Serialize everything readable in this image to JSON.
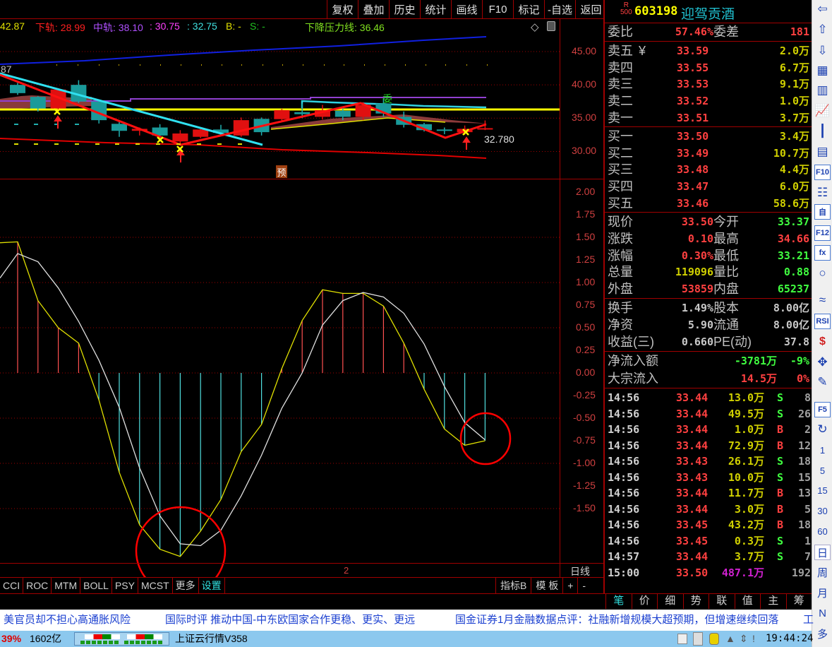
{
  "toolbar": [
    "复权",
    "叠加",
    "历史",
    "统计",
    "画线",
    "F10",
    "标记",
    "-自选",
    "返回"
  ],
  "legend": {
    "upper_value": "42.87",
    "lower_label": "下轨: 28.99",
    "mid_label": "中轨: 38.10",
    "v1": ": 30.75",
    "v2": ": 32.75",
    "b": "B: -",
    "s": "S: -",
    "pressure": "下降压力线: 36.46"
  },
  "chart_labels": {
    "left_value": "87",
    "last_price": "32.780",
    "forecast": "预",
    "sell_mark": "委",
    "period_marker": "2",
    "period": "日线"
  },
  "colors": {
    "up": "#ff2020",
    "down": "#20b0b0",
    "grid": "#a00000",
    "accent": "#00ffff"
  },
  "chart_data": {
    "price_axis": [
      "45.00",
      "40.00",
      "35.00",
      "30.00"
    ],
    "price_ticks": [
      45,
      40,
      35,
      30
    ],
    "candles": [
      [
        40.0,
        38.76,
        40.3,
        38.5
      ],
      [
        38.2,
        36.45,
        38.3,
        36.0
      ],
      [
        36.45,
        39.3,
        39.5,
        36.0
      ],
      [
        40.0,
        37.5,
        40.7,
        37.3
      ],
      [
        37.5,
        34.7,
        37.6,
        34.2
      ],
      [
        34.15,
        33.1,
        34.6,
        32.2
      ],
      [
        33.1,
        33.4,
        33.6,
        32.4
      ],
      [
        33.6,
        32.4,
        34.1,
        31.8
      ],
      [
        31.5,
        32.7,
        33.2,
        31.0
      ],
      [
        32.2,
        33.3,
        33.6,
        32.0
      ],
      [
        33.3,
        32.8,
        34.0,
        32.3
      ],
      [
        32.4,
        34.7,
        35.1,
        32.2
      ],
      [
        34.9,
        32.9,
        35.1,
        32.4
      ],
      [
        34.85,
        36.2,
        36.4,
        34.6
      ],
      [
        35.9,
        35.6,
        37.2,
        35.0
      ],
      [
        35.2,
        36.2,
        37.0,
        34.8
      ],
      [
        36.1,
        35.2,
        36.6,
        34.7
      ],
      [
        35.2,
        37.0,
        37.4,
        34.7
      ],
      [
        37.2,
        35.7,
        37.9,
        35.2
      ],
      [
        35.2,
        34.0,
        36.0,
        33.6
      ],
      [
        34.1,
        33.2,
        34.3,
        33.0
      ],
      [
        33.3,
        33.1,
        33.6,
        32.6
      ],
      [
        32.9,
        33.4,
        33.9,
        32.5
      ],
      [
        33.37,
        33.5,
        34.66,
        33.21
      ]
    ],
    "osc_axis": [
      "2.00",
      "1.75",
      "1.50",
      "1.25",
      "1.00",
      "0.75",
      "0.50",
      "0.25",
      "0.00",
      "-0.25",
      "-0.50",
      "-0.75",
      "-1.00",
      "-1.25",
      "-1.50"
    ],
    "osc_ticks": [
      2,
      1.75,
      1.5,
      1.25,
      1,
      0.75,
      0.5,
      0.25,
      0,
      -0.25,
      -0.5,
      -0.75,
      -1,
      -1.25,
      -1.5
    ],
    "histogram": [
      1.45,
      0.8,
      0.5,
      0.33,
      -0.3,
      -1.1,
      -1.68,
      -1.95,
      -2.03,
      -1.75,
      -1.4,
      -0.87,
      -0.57,
      0.05,
      0.58,
      0.92,
      0.88,
      0.88,
      0.74,
      0.33,
      -0.18,
      -0.62,
      -0.8,
      -0.75
    ],
    "signal": [
      1.32,
      1.23,
      0.94,
      0.57,
      0.14,
      -0.38,
      -1.05,
      -1.58,
      -1.89,
      -1.91,
      -1.74,
      -1.36,
      -0.91,
      -0.39,
      0.0,
      0.53,
      0.8,
      0.89,
      0.84,
      0.66,
      0.32,
      -0.15,
      -0.55,
      -0.74
    ],
    "histogram_start": 1.44,
    "signal_start": 1.05
  },
  "quote": {
    "code": "603198",
    "name": "迎驾贡酒",
    "badge_top": "R",
    "badge_bottom": "500",
    "wb_label": "委比",
    "wb": "57.46%",
    "wc_label": "委差",
    "wc": "181",
    "asks": [
      {
        "l": "卖五",
        "p": "33.59",
        "v": "2.0万"
      },
      {
        "l": "卖四",
        "p": "33.55",
        "v": "6.7万"
      },
      {
        "l": "卖三",
        "p": "33.53",
        "v": "9.1万"
      },
      {
        "l": "卖二",
        "p": "33.52",
        "v": "1.0万"
      },
      {
        "l": "卖一",
        "p": "33.51",
        "v": "3.7万"
      }
    ],
    "ask_mark": "¥",
    "bids": [
      {
        "l": "买一",
        "p": "33.50",
        "v": "3.4万"
      },
      {
        "l": "买二",
        "p": "33.49",
        "v": "10.7万"
      },
      {
        "l": "买三",
        "p": "33.48",
        "v": "4.4万"
      },
      {
        "l": "买四",
        "p": "33.47",
        "v": "6.0万"
      },
      {
        "l": "买五",
        "p": "33.46",
        "v": "58.6万"
      }
    ],
    "stats": [
      {
        "l1": "现价",
        "v1": "33.50",
        "c1": "#ff4040",
        "l2": "今开",
        "v2": "33.37",
        "c2": "#40ff40"
      },
      {
        "l1": "涨跌",
        "v1": "0.10",
        "c1": "#ff4040",
        "l2": "最高",
        "v2": "34.66",
        "c2": "#ff4040"
      },
      {
        "l1": "涨幅",
        "v1": "0.30%",
        "c1": "#ff4040",
        "l2": "最低",
        "v2": "33.21",
        "c2": "#40ff40"
      },
      {
        "l1": "总量",
        "v1": "119096",
        "c1": "#d0d000",
        "l2": "量比",
        "v2": "0.88",
        "c2": "#40ff40"
      },
      {
        "l1": "外盘",
        "v1": "53859",
        "c1": "#ff4040",
        "l2": "内盘",
        "v2": "65237",
        "c2": "#40ff40"
      }
    ],
    "fin": [
      {
        "l1": "换手",
        "v1": "1.49%",
        "l2": "股本",
        "v2": "8.00亿"
      },
      {
        "l1": "净资",
        "v1": "5.90",
        "l2": "流通",
        "v2": "8.00亿"
      },
      {
        "l1": "收益(三)",
        "v1": "0.660",
        "l2": "PE(动)",
        "v2": "37.8"
      }
    ],
    "flow": [
      {
        "l": "净流入额",
        "v": "-3781万",
        "p": "-9%",
        "c": "#40ff40"
      },
      {
        "l": "大宗流入",
        "v": "14.5万",
        "p": "0%",
        "c": "#ff4040"
      }
    ],
    "trades": [
      {
        "t": "14:56",
        "p": "33.44",
        "v": "13.0万",
        "s": "S",
        "n": "8"
      },
      {
        "t": "14:56",
        "p": "33.44",
        "v": "49.5万",
        "s": "S",
        "n": "26"
      },
      {
        "t": "14:56",
        "p": "33.44",
        "v": "1.0万",
        "s": "B",
        "n": "2"
      },
      {
        "t": "14:56",
        "p": "33.44",
        "v": "72.9万",
        "s": "B",
        "n": "12"
      },
      {
        "t": "14:56",
        "p": "33.43",
        "v": "26.1万",
        "s": "S",
        "n": "18"
      },
      {
        "t": "14:56",
        "p": "33.43",
        "v": "10.0万",
        "s": "S",
        "n": "15"
      },
      {
        "t": "14:56",
        "p": "33.44",
        "v": "11.7万",
        "s": "B",
        "n": "13"
      },
      {
        "t": "14:56",
        "p": "33.44",
        "v": "3.0万",
        "s": "B",
        "n": "5"
      },
      {
        "t": "14:56",
        "p": "33.45",
        "v": "43.2万",
        "s": "B",
        "n": "18"
      },
      {
        "t": "14:56",
        "p": "33.45",
        "v": "0.3万",
        "s": "S",
        "n": "1"
      },
      {
        "t": "14:57",
        "p": "33.44",
        "v": "3.7万",
        "s": "S",
        "n": "7"
      },
      {
        "t": "15:00",
        "p": "33.50",
        "v": "487.1万",
        "s": "",
        "n": "192"
      }
    ]
  },
  "indicator_tabs": [
    "CCI",
    "ROC",
    "MTM",
    "BOLL",
    "PSY",
    "MCST",
    "更多",
    "设置"
  ],
  "indicator_right": [
    "指标B",
    "模 板",
    "+",
    "-"
  ],
  "right_tabs": [
    "笔",
    "价",
    "细",
    "势",
    "联",
    "值",
    "主",
    "筹"
  ],
  "sidebar_periods": [
    "1",
    "5",
    "15",
    "30",
    "60",
    "日",
    "周",
    "月",
    "N",
    "多"
  ],
  "sidebar_icons": [
    "arrow-left-icon",
    "arrow-up-icon",
    "arrow-down-icon",
    "quote-list-icon",
    "multi-stock-icon",
    "line-chart-icon",
    "kline-icon",
    "windows-icon",
    "f10-icon",
    "tree-icon",
    "self-icon",
    "f12-icon",
    "formula-icon",
    "circle-icon",
    "wave-icon",
    "rsi-icon",
    "dollar-icon",
    "move-icon",
    "pencil-icon",
    "f5-icon",
    "refresh-icon"
  ],
  "sidebar_icon_text": {
    "f10-icon": "F10",
    "f12-icon": "F12",
    "rsi-icon": "RSI",
    "dollar-icon": "$",
    "f5-icon": "F5",
    "self-icon": "自",
    "formula-icon": "fx"
  },
  "news": [
    "美官员却不担心高通胀风险",
    "国际时评  推动中国-中东欧国家合作更稳、更实、更远",
    "国金证券1月金融数据点评：社融新增规模大超预期，但增速继续回落",
    "工"
  ],
  "status": {
    "pct": "39%",
    "amount": "1602亿",
    "app": "上证云行情V358",
    "time": "19:44:24"
  }
}
